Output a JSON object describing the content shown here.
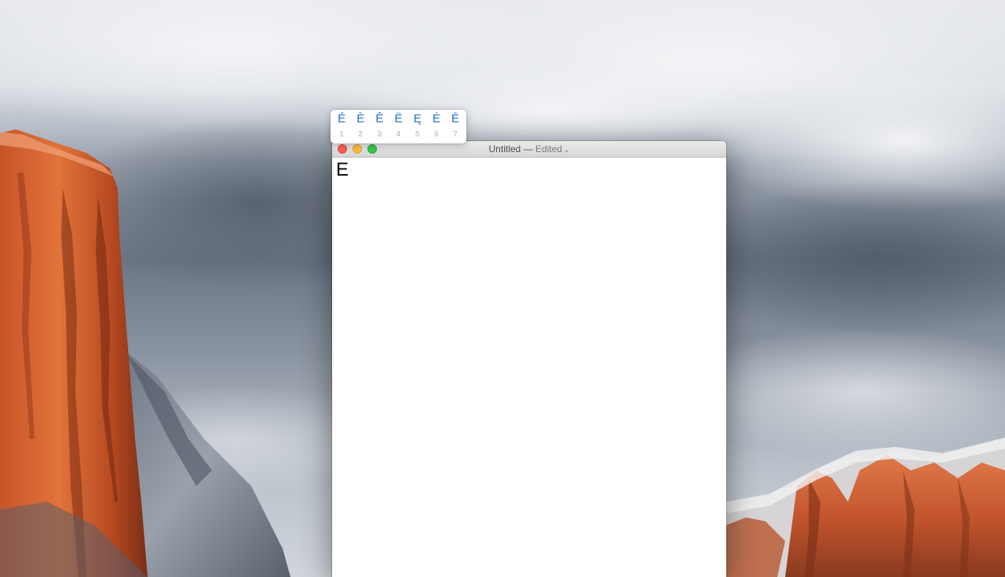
{
  "window": {
    "title": "Untitled",
    "separator": "—",
    "status": "Edited",
    "chevron": "⌄"
  },
  "document": {
    "text": "E"
  },
  "accent_popover": {
    "items": [
      {
        "glyph": "É",
        "number": "1"
      },
      {
        "glyph": "È",
        "number": "2"
      },
      {
        "glyph": "Ê",
        "number": "3"
      },
      {
        "glyph": "Ë",
        "number": "4"
      },
      {
        "glyph": "Ę",
        "number": "5"
      },
      {
        "glyph": "Ė",
        "number": "6"
      },
      {
        "glyph": "Ē",
        "number": "7"
      }
    ],
    "glyph_color": "#1f6fd0"
  },
  "traffic_lights": {
    "close_color": "#fc605b",
    "minimize_color": "#fdbc40",
    "zoom_color": "#34c84a"
  }
}
